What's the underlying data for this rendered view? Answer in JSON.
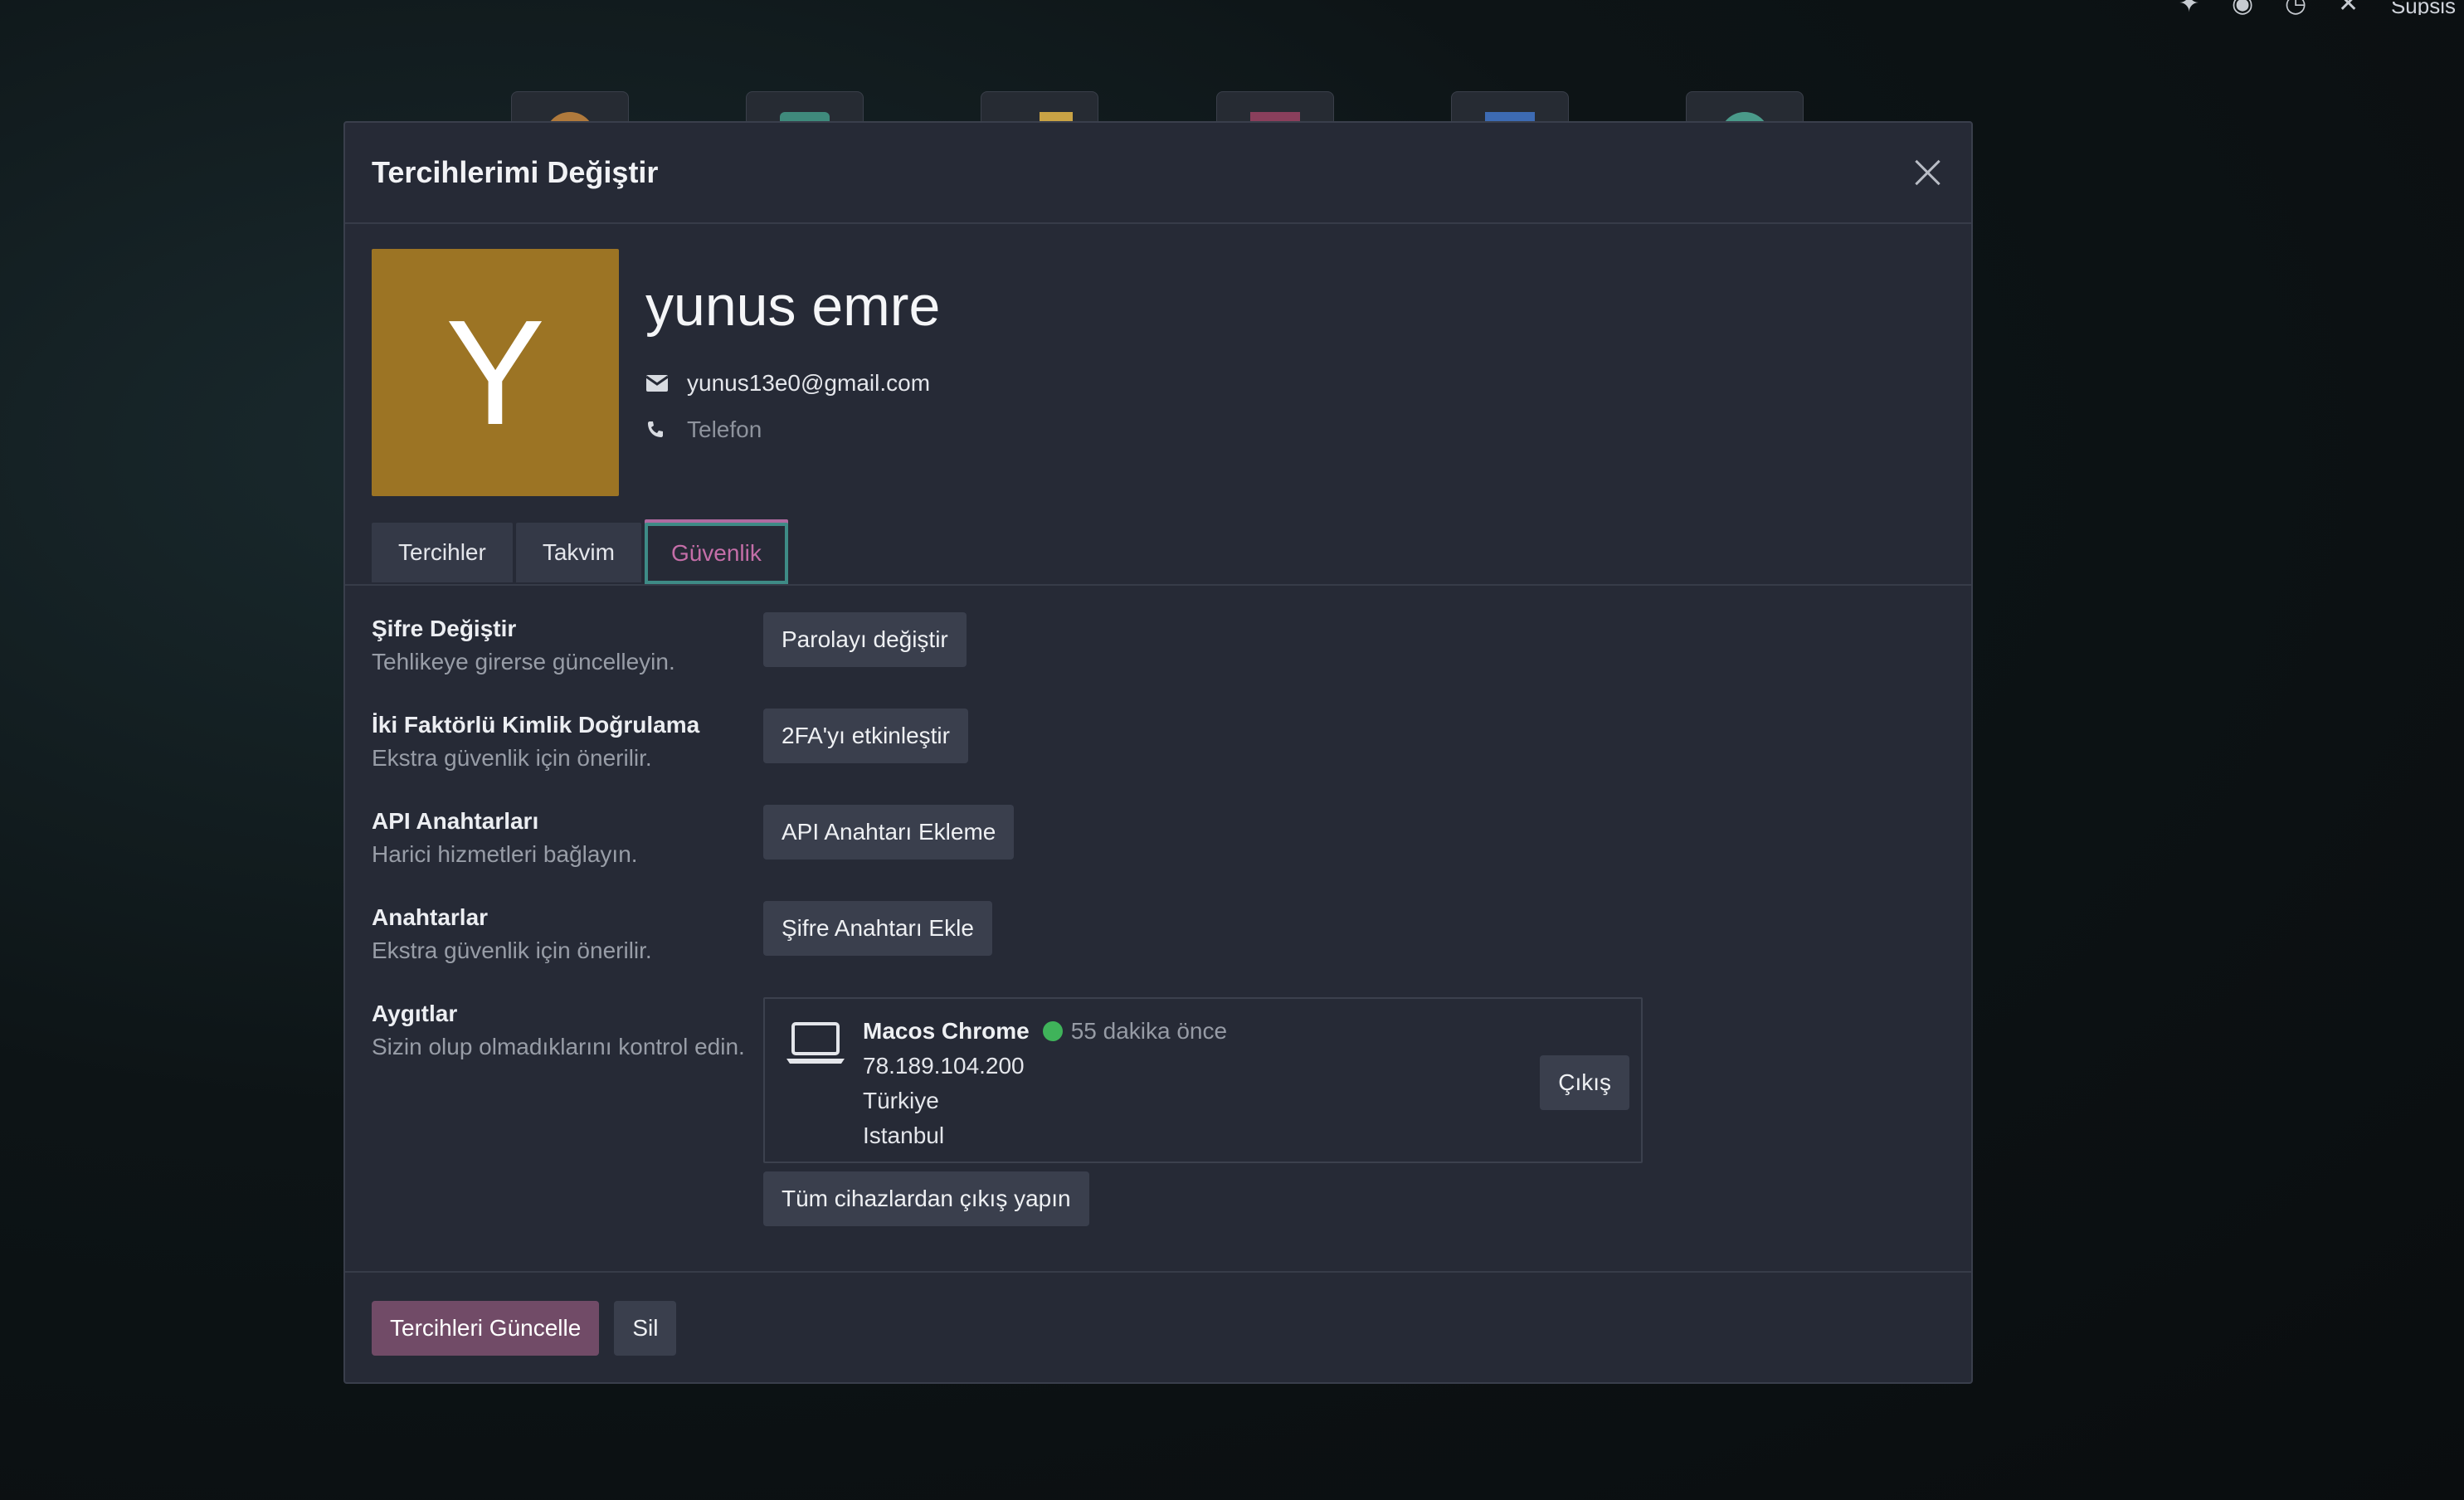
{
  "topbar": {
    "brand_label": "Supsis"
  },
  "modal": {
    "title": "Tercihlerimi Değiştir"
  },
  "profile": {
    "avatar_letter": "Y",
    "avatar_color": "#9c7424",
    "name": "yunus emre",
    "email": "yunus13e0@gmail.com",
    "phone_placeholder": "Telefon"
  },
  "tabs": [
    {
      "label": "Tercihler",
      "active": false
    },
    {
      "label": "Takvim",
      "active": false
    },
    {
      "label": "Güvenlik",
      "active": true
    }
  ],
  "security": {
    "password": {
      "title": "Şifre Değiştir",
      "desc": "Tehlikeye girerse güncelleyin.",
      "button": "Parolayı değiştir"
    },
    "twofa": {
      "title": "İki Faktörlü Kimlik Doğrulama",
      "desc": "Ekstra güvenlik için önerilir.",
      "button": "2FA'yı etkinleştir"
    },
    "api": {
      "title": "API Anahtarları",
      "desc": "Harici hizmetleri bağlayın.",
      "button": "API Anahtarı Ekleme"
    },
    "passkeys": {
      "title": "Anahtarlar",
      "desc": "Ekstra güvenlik için önerilir.",
      "button": "Şifre Anahtarı Ekle"
    },
    "devices": {
      "title": "Aygıtlar",
      "desc": "Sizin olup olmadıklarını kontrol edin.",
      "items": [
        {
          "name": "Macos Chrome",
          "status_color": "#3fb35a",
          "last_seen": "55 dakika önce",
          "ip": "78.189.104.200",
          "country": "Türkiye",
          "city": "Istanbul",
          "logout_label": "Çıkış"
        }
      ],
      "logout_all_label": "Tüm cihazlardan çıkış yapın"
    }
  },
  "footer": {
    "update_label": "Tercihleri Güncelle",
    "delete_label": "Sil"
  },
  "colors": {
    "primary": "#714b67",
    "active_tab_text": "#c46ea8",
    "active_tab_border": "#3e8b86"
  }
}
